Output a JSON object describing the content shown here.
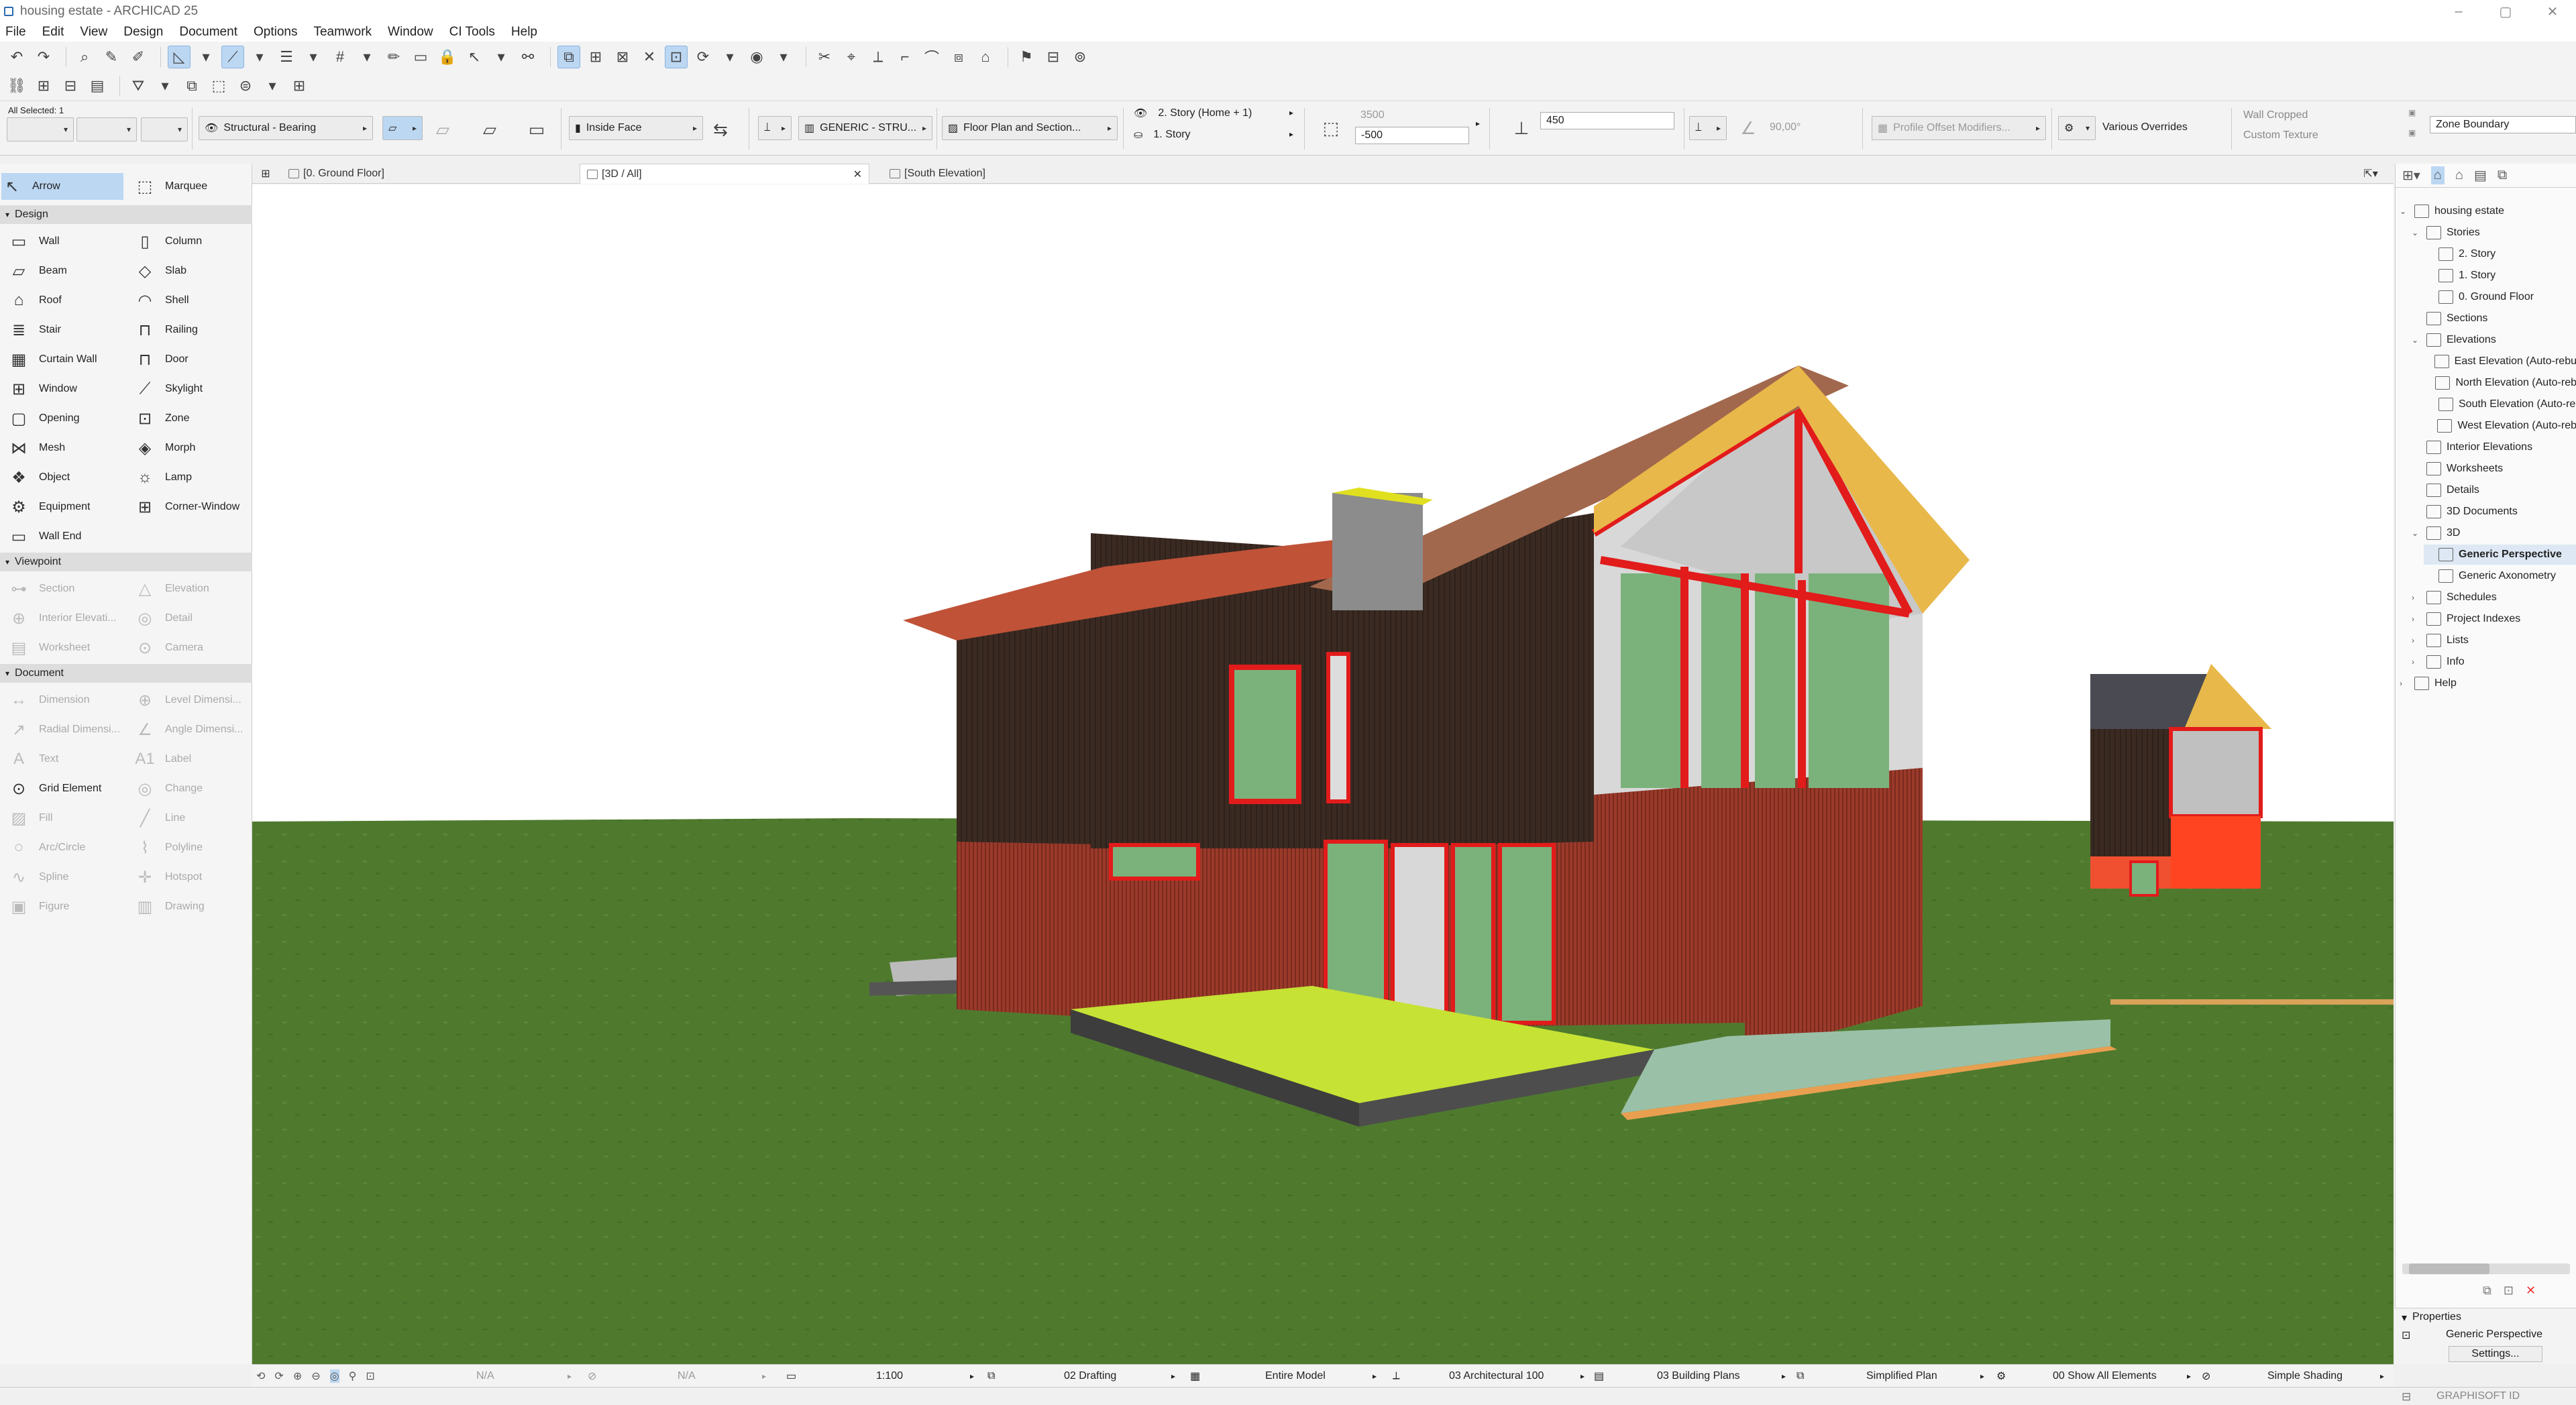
{
  "window": {
    "title": "housing estate - ARCHICAD 25"
  },
  "menu": [
    "File",
    "Edit",
    "View",
    "Design",
    "Document",
    "Options",
    "Teamwork",
    "Window",
    "CI Tools",
    "Help"
  ],
  "infobox": {
    "all_selected": "All Selected: 1",
    "structure": "Structural - Bearing",
    "reference_line": "Inside Face",
    "composite": "GENERIC - STRU...",
    "floor_plan_display": "Floor Plan and Section...",
    "home_story": "2. Story (Home + 1)",
    "top_story": "1. Story",
    "height": "3500",
    "offset": "-500",
    "thickness": "450",
    "angle": "90,00°",
    "profile_modifiers": "Profile Offset Modifiers...",
    "overrides": "Various Overrides",
    "wall_cropped": "Wall Cropped",
    "custom_texture": "Custom Texture",
    "zone_boundary": "Zone Boundary"
  },
  "tabs": [
    {
      "label": "[0. Ground Floor]"
    },
    {
      "label": "[3D / All]"
    },
    {
      "label": "[South Elevation]"
    }
  ],
  "toolbox": {
    "arrow": "Arrow",
    "marquee": "Marquee",
    "design_header": "Design",
    "design_tools": [
      [
        "Wall",
        "Column"
      ],
      [
        "Beam",
        "Slab"
      ],
      [
        "Roof",
        "Shell"
      ],
      [
        "Stair",
        "Railing"
      ],
      [
        "Curtain Wall",
        "Door"
      ],
      [
        "Window",
        "Skylight"
      ],
      [
        "Opening",
        "Zone"
      ],
      [
        "Mesh",
        "Morph"
      ],
      [
        "Object",
        "Lamp"
      ],
      [
        "Equipment",
        "Corner-Window"
      ],
      [
        "Wall End",
        ""
      ]
    ],
    "viewpoint_header": "Viewpoint",
    "viewpoint_tools": [
      [
        "Section",
        "Elevation"
      ],
      [
        "Interior Elevati...",
        "Detail"
      ],
      [
        "Worksheet",
        "Camera"
      ]
    ],
    "document_header": "Document",
    "document_tools": [
      [
        "Dimension",
        "Level Dimensi..."
      ],
      [
        "Radial Dimensi...",
        "Angle Dimensi..."
      ],
      [
        "Text",
        "Label"
      ],
      [
        "Grid Element",
        "Change"
      ],
      [
        "Fill",
        "Line"
      ],
      [
        "Arc/Circle",
        "Polyline"
      ],
      [
        "Spline",
        "Hotspot"
      ],
      [
        "Figure",
        "Drawing"
      ]
    ]
  },
  "navigator": {
    "items": [
      {
        "label": "housing estate",
        "level": 0,
        "exp": "⌄"
      },
      {
        "label": "Stories",
        "level": 1,
        "exp": "⌄"
      },
      {
        "label": "2. Story",
        "level": 2,
        "exp": ""
      },
      {
        "label": "1. Story",
        "level": 2,
        "exp": ""
      },
      {
        "label": "0. Ground Floor",
        "level": 2,
        "exp": ""
      },
      {
        "label": "Sections",
        "level": 1,
        "exp": ""
      },
      {
        "label": "Elevations",
        "level": 1,
        "exp": "⌄"
      },
      {
        "label": "East Elevation (Auto-rebu",
        "level": 2,
        "exp": ""
      },
      {
        "label": "North Elevation (Auto-reb",
        "level": 2,
        "exp": ""
      },
      {
        "label": "South Elevation (Auto-re",
        "level": 2,
        "exp": ""
      },
      {
        "label": "West Elevation (Auto-reb",
        "level": 2,
        "exp": ""
      },
      {
        "label": "Interior Elevations",
        "level": 1,
        "exp": ""
      },
      {
        "label": "Worksheets",
        "level": 1,
        "exp": ""
      },
      {
        "label": "Details",
        "level": 1,
        "exp": ""
      },
      {
        "label": "3D Documents",
        "level": 1,
        "exp": ""
      },
      {
        "label": "3D",
        "level": 1,
        "exp": "⌄"
      },
      {
        "label": "Generic Perspective",
        "level": 2,
        "exp": "",
        "sel": true
      },
      {
        "label": "Generic Axonometry",
        "level": 2,
        "exp": ""
      },
      {
        "label": "Schedules",
        "level": 1,
        "exp": "›"
      },
      {
        "label": "Project Indexes",
        "level": 1,
        "exp": "›"
      },
      {
        "label": "Lists",
        "level": 1,
        "exp": "›"
      },
      {
        "label": "Info",
        "level": 1,
        "exp": "›"
      },
      {
        "label": "Help",
        "level": 0,
        "exp": "›"
      }
    ],
    "properties_header": "Properties",
    "properties_value": "Generic Perspective",
    "settings": "Settings..."
  },
  "statusbar": {
    "na1": "N/A",
    "na2": "N/A",
    "scale": "1:100",
    "layer": "02 Drafting",
    "model": "Entire Model",
    "pen_set": "03 Architectural 100",
    "model_view": "03 Building Plans",
    "plan_type": "Simplified Plan",
    "renovation": "00 Show All Elements",
    "shading": "Simple Shading"
  },
  "bottom": {
    "graphisoft": "GRAPHISOFT ID"
  }
}
